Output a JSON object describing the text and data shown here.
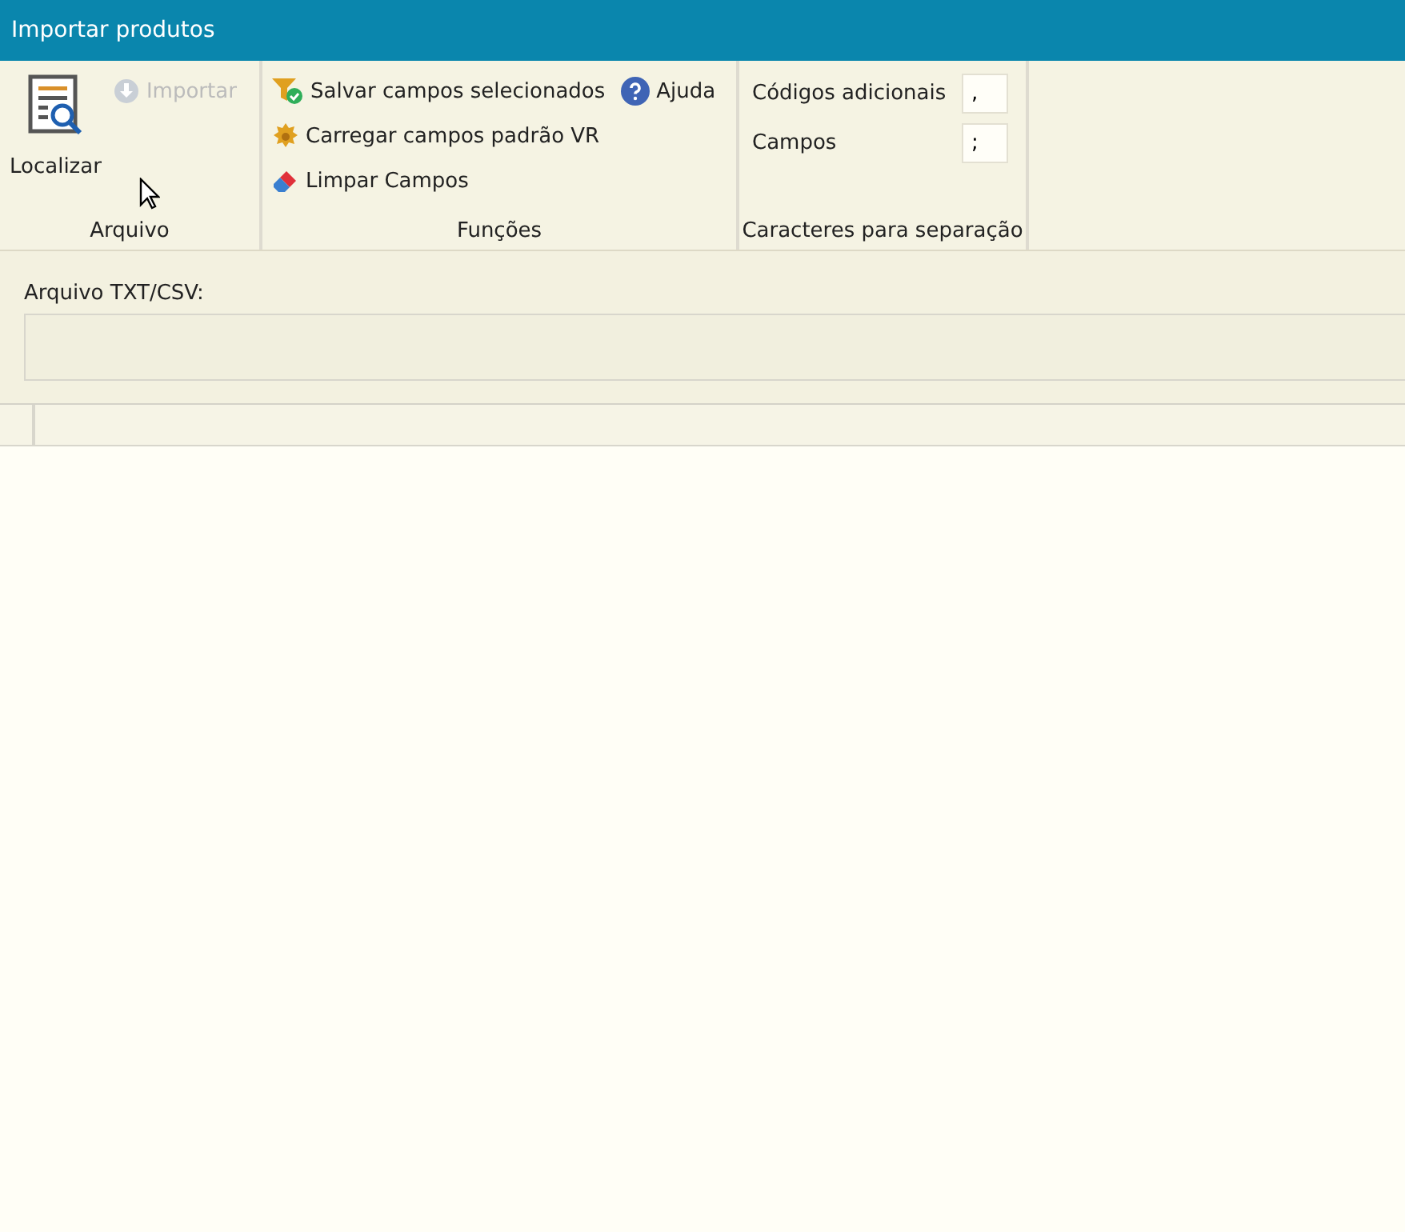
{
  "window": {
    "title": "Importar produtos"
  },
  "ribbon": {
    "groups": [
      {
        "kind": "arquivo",
        "label": "Arquivo",
        "large_button": {
          "label": "Localizar"
        },
        "small_button": {
          "label": "Importar",
          "disabled": true
        }
      },
      {
        "kind": "funcoes",
        "label": "Funções",
        "buttons": [
          {
            "label": "Salvar campos selecionados",
            "disabled": false
          },
          {
            "label": "Carregar campos padrão VR",
            "disabled": false
          },
          {
            "label": "Limpar Campos",
            "disabled": false
          }
        ],
        "help_button": {
          "label": "Ajuda",
          "disabled": false
        }
      },
      {
        "kind": "separadores",
        "label": "Caracteres para separação",
        "fields": [
          {
            "label": "Códigos adicionais",
            "value": ","
          },
          {
            "label": "Campos",
            "value": ";"
          }
        ]
      }
    ]
  },
  "file_field": {
    "label": "Arquivo TXT/CSV:"
  },
  "grid": {
    "kind": "empty"
  }
}
